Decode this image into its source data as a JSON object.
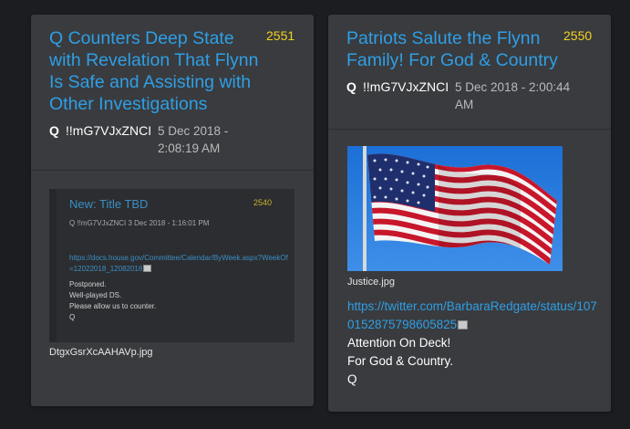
{
  "posts": [
    {
      "title": "Q Counters Deep State with Revelation That Flynn Is Safe and Assisting with Other Investigations",
      "number": "2551",
      "author": "Q",
      "tripcode": "!!mG7VJxZNCI",
      "date": "5 Dec 2018 - 2:08:19 AM",
      "image_filename": "DtgxGsrXcAAHAVp.jpg",
      "embedded": {
        "title": "New: Title TBD",
        "number": "2540",
        "meta": "Q  !!mG7VJxZNCI  3 Dec 2018 - 1:16:01 PM",
        "link": "https://docs.house.gov/Committee/Calendar/ByWeek.aspx?WeekOf=12022018_12082018",
        "lines": [
          "Postponed.",
          "Well-played DS.",
          "Please allow us to counter.",
          "Q"
        ]
      }
    },
    {
      "title": "Patriots Salute the Flynn Family! For God & Country",
      "number": "2550",
      "author": "Q",
      "tripcode": "!!mG7VJxZNCI",
      "date": "5 Dec 2018 - 2:00:44 AM",
      "image_filename": "Justice.jpg",
      "link": "https://twitter.com/BarbaraRedgate/status/1070152875798605825",
      "lines": [
        "Attention On Deck!",
        "For God & Country.",
        "Q"
      ]
    }
  ],
  "colors": {
    "link": "#2e9fe6",
    "number": "#f3d321",
    "card": "#3a3b3e",
    "background": "#1c1d20"
  }
}
